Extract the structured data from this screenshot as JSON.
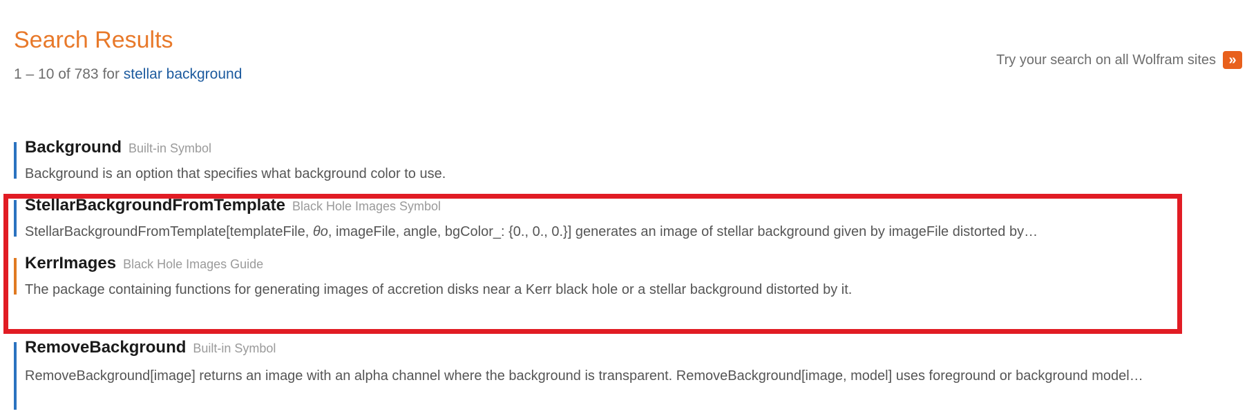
{
  "header": {
    "title": "Search Results",
    "count_prefix": "1 – 10 of 783 for",
    "query": "stellar background",
    "all_sites_label": "Try your search on all Wolfram sites",
    "all_sites_icon": "»"
  },
  "results": [
    {
      "title": "Background",
      "type": "Built-in Symbol",
      "description": "Background is an option that specifies what background color to use."
    },
    {
      "title": "StellarBackgroundFromTemplate",
      "type": "Black Hole Images Symbol",
      "description_before": "StellarBackgroundFromTemplate[templateFile, ",
      "description_theta": "θo",
      "description_after": ", imageFile,  angle, bgColor_: {0., 0., 0.}] generates an image of stellar background given by imageFile distorted by…"
    },
    {
      "title": "KerrImages",
      "type": "Black Hole Images Guide",
      "description": "The package containing functions for generating images of accretion disks near a Kerr black hole or a stellar background distorted by it."
    },
    {
      "title": "RemoveBackground",
      "type": "Built-in Symbol",
      "description": "RemoveBackground[image] returns an image with an alpha channel where the background is transparent. RemoveBackground[image, model] uses foreground or background model…"
    }
  ],
  "colors": {
    "accent_orange": "#e8792a",
    "link_blue": "#1c5a9e",
    "bar_blue": "#2b73c0",
    "bar_orange": "#e07a22",
    "highlight_red": "#e11c24"
  }
}
